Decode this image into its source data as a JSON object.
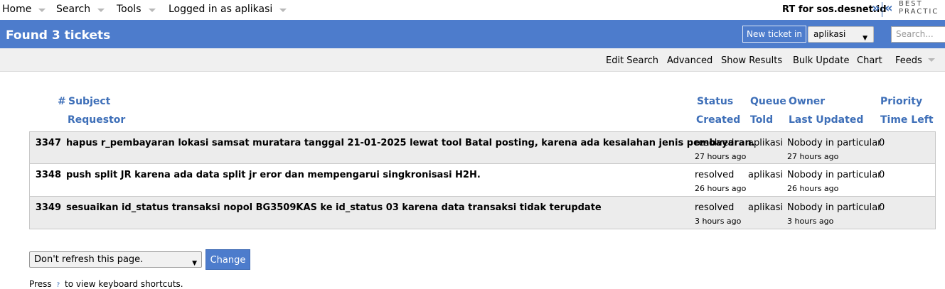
{
  "top_menu": {
    "items": [
      "Home",
      "Search",
      "Tools",
      "Logged in as aplikasi"
    ],
    "rt_for": "RT for sos.desnet.id",
    "logo_text": "BEST PRACTIC"
  },
  "title_bar": {
    "title": "Found 3 tickets",
    "new_ticket_label": "New ticket in",
    "queue_value": "aplikasi",
    "search_placeholder": "Search..."
  },
  "action_menu": [
    "Edit Search",
    "Advanced",
    "Show Results",
    "Bulk Update",
    "Chart",
    "Feeds"
  ],
  "columns": {
    "row1": [
      "#",
      "Subject",
      "Status",
      "Queue",
      "Owner",
      "Priority"
    ],
    "row2": [
      "Requestor",
      "Created",
      "Told",
      "Last Updated",
      "Time Left"
    ]
  },
  "tickets": [
    {
      "id": "3347",
      "subject": "hapus r_pembayaran lokasi samsat muratara tanggal 21-01-2025 lewat tool Batal posting, karena ada kesalahan jenis pembayaran.",
      "status": "resolved",
      "queue": "aplikasi",
      "owner": "Nobody in particular",
      "priority": "0",
      "created": "27 hours ago",
      "last_updated": "27 hours ago"
    },
    {
      "id": "3348",
      "subject": "push split JR karena ada data split jr eror dan mempengarui singkronisasi H2H.",
      "status": "resolved",
      "queue": "aplikasi",
      "owner": "Nobody in particular",
      "priority": "0",
      "created": "26 hours ago",
      "last_updated": "26 hours ago"
    },
    {
      "id": "3349",
      "subject": "sesuaikan id_status transaksi nopol BG3509KAS ke id_status 03 karena data transaksi tidak terupdate",
      "status": "resolved",
      "queue": "aplikasi",
      "owner": "Nobody in particular",
      "priority": "0",
      "created": "3 hours ago",
      "last_updated": "3 hours ago"
    }
  ],
  "footer": {
    "refresh_value": "Don't refresh this page.",
    "change_label": "Change",
    "hint_prefix": "Press",
    "hint_key": "?",
    "hint_suffix": "to view keyboard shortcuts."
  },
  "colors": {
    "title_bar_bg": "#4d7ccc",
    "header_text": "#3e6fb8",
    "row_shade": "#ececec"
  }
}
